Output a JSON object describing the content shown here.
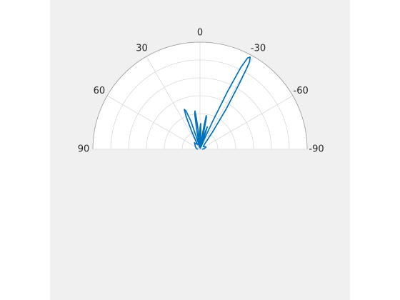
{
  "chart_data": {
    "type": "polar-line",
    "theta_ticks": [
      {
        "angle": 0,
        "label": "0"
      },
      {
        "angle": 30,
        "label": "30"
      },
      {
        "angle": -30,
        "label": "-30"
      },
      {
        "angle": 60,
        "label": "60"
      },
      {
        "angle": -60,
        "label": "-60"
      },
      {
        "angle": 90,
        "label": "90"
      },
      {
        "angle": -90,
        "label": "-90"
      }
    ],
    "theta_range": [
      -90,
      90
    ],
    "theta_direction": "clockwise-negative",
    "r_ring_count": 6,
    "r_range": [
      0,
      1
    ],
    "grid": true,
    "series": [
      {
        "color": "#0072bd",
        "points": [
          [
            -90,
            0.02
          ],
          [
            -80,
            0.04
          ],
          [
            -70,
            0.06
          ],
          [
            -60,
            0.05
          ],
          [
            -50,
            0.04
          ],
          [
            -45,
            0.05
          ],
          [
            -40,
            0.08
          ],
          [
            -36,
            0.2
          ],
          [
            -33,
            0.45
          ],
          [
            -31,
            0.7
          ],
          [
            -30,
            0.87
          ],
          [
            -29.5,
            0.94
          ],
          [
            -28.5,
            0.98
          ],
          [
            -27.5,
            0.96
          ],
          [
            -26.5,
            0.85
          ],
          [
            -25.5,
            0.6
          ],
          [
            -24.5,
            0.3
          ],
          [
            -23,
            0.1
          ],
          [
            -21,
            0.02
          ],
          [
            -19.5,
            0.08
          ],
          [
            -18,
            0.22
          ],
          [
            -17,
            0.18
          ],
          [
            -15.5,
            0.06
          ],
          [
            -14,
            0.01
          ],
          [
            -12.5,
            0.14
          ],
          [
            -11.5,
            0.3
          ],
          [
            -10.5,
            0.32
          ],
          [
            -9.5,
            0.2
          ],
          [
            -8,
            0.04
          ],
          [
            -6,
            0.02
          ],
          [
            -3,
            0.15
          ],
          [
            -1.5,
            0.24
          ],
          [
            0,
            0.2
          ],
          [
            1.5,
            0.1
          ],
          [
            3,
            0.02
          ],
          [
            5,
            0.15
          ],
          [
            6.5,
            0.28
          ],
          [
            7.5,
            0.36
          ],
          [
            8.5,
            0.33
          ],
          [
            9.5,
            0.2
          ],
          [
            11,
            0.05
          ],
          [
            13,
            0.02
          ],
          [
            16,
            0.1
          ],
          [
            18,
            0.28
          ],
          [
            20,
            0.38
          ],
          [
            21.5,
            0.4
          ],
          [
            23,
            0.33
          ],
          [
            25,
            0.18
          ],
          [
            28,
            0.05
          ],
          [
            33,
            0.06
          ],
          [
            40,
            0.08
          ],
          [
            50,
            0.06
          ],
          [
            60,
            0.05
          ],
          [
            70,
            0.04
          ],
          [
            80,
            0.03
          ],
          [
            90,
            0.02
          ]
        ]
      }
    ]
  }
}
